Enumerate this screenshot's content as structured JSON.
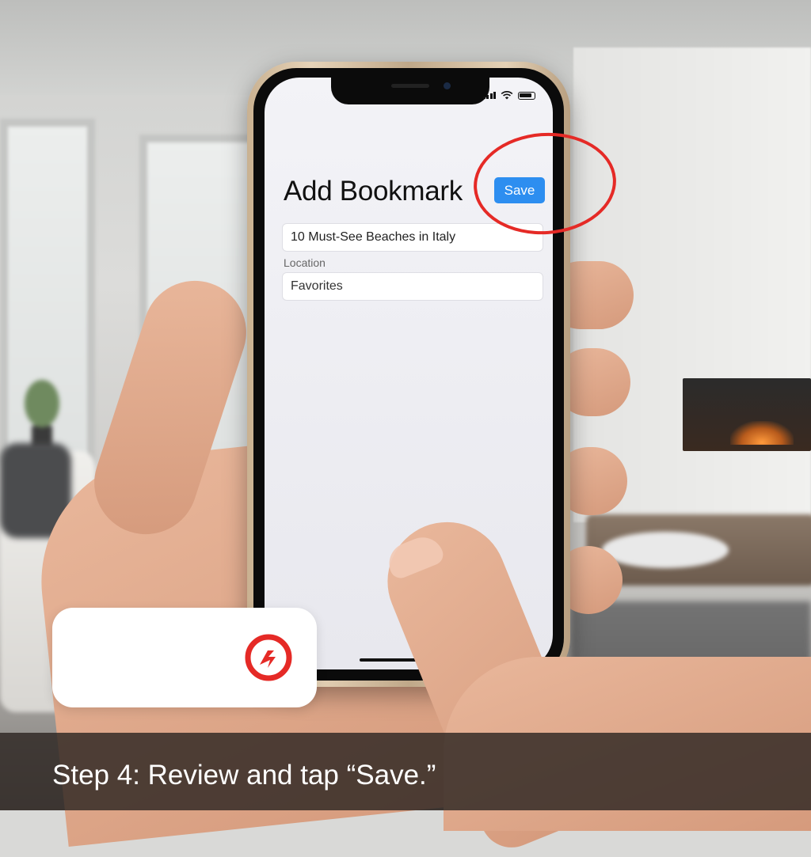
{
  "screen": {
    "title": "Add Bookmark",
    "save_label": "Save",
    "bookmark_title_value": "10 Must-See Beaches in Italy",
    "location_label": "Location",
    "location_value": "Favorites",
    "status_icons": [
      "cellular-signal-icon",
      "wifi-icon",
      "battery-icon"
    ]
  },
  "caption": "Step 4: Review and tap “Save.”",
  "colors": {
    "save_button": "#2d8ef0",
    "highlight_circle": "#e52a26",
    "caption_bar": "#2d2622"
  },
  "logo_icon": "refresh-arrow-logo-icon"
}
